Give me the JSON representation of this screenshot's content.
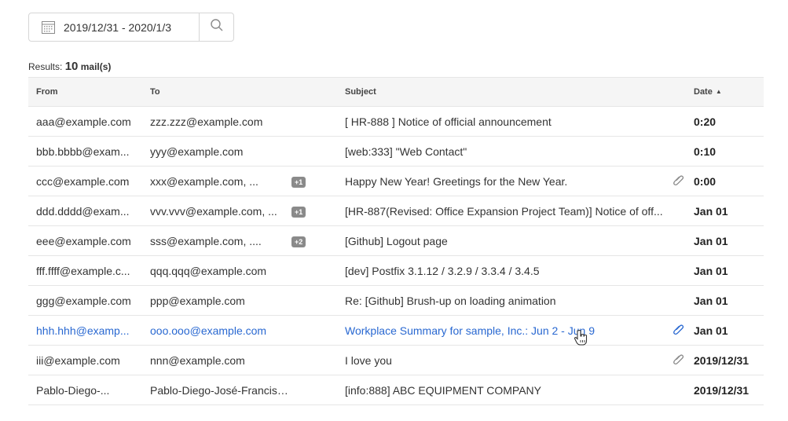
{
  "search": {
    "date_range": "2019/12/31 - 2020/1/3"
  },
  "results": {
    "prefix": "Results: ",
    "count": "10",
    "unit": "mail(s)"
  },
  "columns": {
    "from": "From",
    "to": "To",
    "subject": "Subject",
    "date": "Date"
  },
  "rows": [
    {
      "from": "aaa@example.com",
      "to": "zzz.zzz@example.com",
      "badge": "",
      "subject": "[ HR-888 ] Notice of official announcement",
      "attachment": false,
      "date": "0:20"
    },
    {
      "from": "bbb.bbbb@exam...",
      "to": "yyy@example.com",
      "badge": "",
      "subject": "[web:333] \"Web Contact\"",
      "attachment": false,
      "date": "0:10"
    },
    {
      "from": "ccc@example.com",
      "to": "xxx@example.com, ...",
      "badge": "+1",
      "subject": "Happy New Year! Greetings for the New Year.",
      "attachment": true,
      "date": "0:00"
    },
    {
      "from": "ddd.dddd@exam...",
      "to": "vvv.vvv@example.com, ...",
      "badge": "+1",
      "subject": "[HR-887(Revised: Office Expansion Project Team)] Notice of off...",
      "attachment": false,
      "date": "Jan 01"
    },
    {
      "from": "eee@example.com",
      "to": "sss@example.com, ....",
      "badge": "+2",
      "subject": "[Github] Logout page",
      "attachment": false,
      "date": "Jan 01"
    },
    {
      "from": "fff.ffff@example.c...",
      "to": "qqq.qqq@example.com",
      "badge": "",
      "subject": "[dev] Postfix 3.1.12 / 3.2.9 / 3.3.4 / 3.4.5",
      "attachment": false,
      "date": "Jan 01"
    },
    {
      "from": "ggg@example.com",
      "to": "ppp@example.com",
      "badge": "",
      "subject": "Re: [Github] Brush-up on loading animation",
      "attachment": false,
      "date": "Jan 01"
    },
    {
      "from": "hhh.hhh@examp...",
      "to": "ooo.ooo@example.com",
      "badge": "",
      "subject": "Workplace Summary for sample, Inc.: Jun 2 - Jun 9",
      "attachment": true,
      "date": "Jan 01",
      "active": true
    },
    {
      "from": "iii@example.com",
      "to": "nnn@example.com",
      "badge": "",
      "subject": "I love you",
      "attachment": true,
      "date": "2019/12/31"
    },
    {
      "from": "Pablo-Diego-...",
      "to": "Pablo-Diego-José-Francisc...",
      "badge": "",
      "subject": "[info:888] ABC EQUIPMENT COMPANY",
      "attachment": false,
      "date": "2019/12/31"
    }
  ],
  "colors": {
    "link_blue": "#2968d1",
    "badge_gray": "#8a8a8a",
    "header_bg": "#f5f5f5"
  },
  "icons": {
    "calendar": "calendar-icon",
    "search": "search-icon",
    "attachment": "paperclip-icon",
    "sort": "sort-ascending-icon",
    "cursor": "hand-cursor-icon"
  }
}
